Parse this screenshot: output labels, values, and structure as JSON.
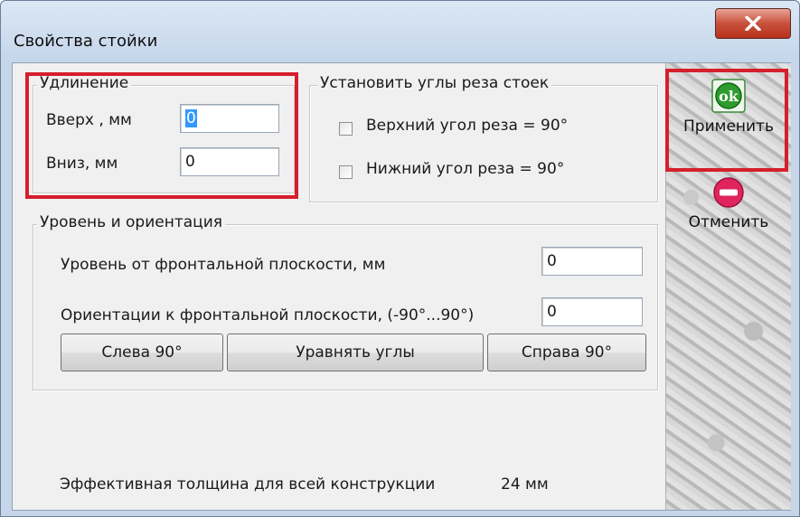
{
  "window": {
    "title": "Свойства стойки"
  },
  "extension": {
    "legend": "Удлинение",
    "up_label": "Вверх , мм",
    "up_value": "0",
    "down_label": "Вниз, мм",
    "down_value": "0"
  },
  "cut_angles": {
    "legend": "Установить углы реза стоек",
    "top_label": "Верхний угол реза = 90°",
    "bottom_label": "Нижний угол реза = 90°"
  },
  "level": {
    "legend": "Уровень и ориентация",
    "level_label": "Уровень от фронтальной плоскости, мм",
    "level_value": "0",
    "orient_label": "Ориентации к фронтальной плоскости, (-90°...90°)",
    "orient_value": "0",
    "left_btn": "Слева 90°",
    "equalize_btn": "Уравнять углы",
    "right_btn": "Справа 90°"
  },
  "status": {
    "thickness_label": "Эффективная толщина для всей конструкции",
    "thickness_value": "24 мм"
  },
  "side": {
    "apply_label": "Применить",
    "apply_icon_text": "ok",
    "cancel_label": "Отменить"
  },
  "colors": {
    "highlight": "#d61f2c",
    "ok_green": "#2e9b2e",
    "cancel_red": "#e0245e"
  }
}
